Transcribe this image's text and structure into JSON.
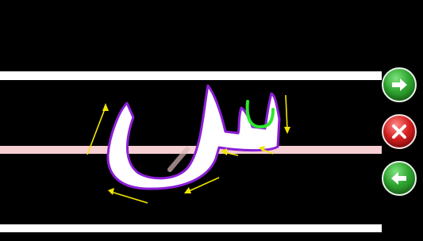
{
  "app": {
    "screen": "letter-tracing"
  },
  "letter": {
    "glyph": "س",
    "fill_color": "#ffffff",
    "outline_color": "#8b1fd6",
    "start_hint_color": "#2ee82e",
    "arrow_color": "#f2e600"
  },
  "lines": {
    "guide_color": "#ffffff",
    "baseline_color": "#f6cfd2"
  },
  "controls": {
    "next_icon": "arrow-right-icon",
    "clear_icon": "x-icon",
    "prev_icon": "arrow-left-icon"
  }
}
